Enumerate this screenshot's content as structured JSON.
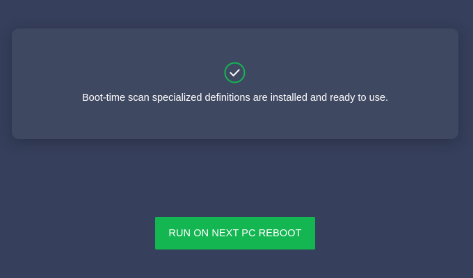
{
  "card": {
    "icon": "check-circle-icon",
    "message": "Boot-time scan specialized definitions are installed and ready to use."
  },
  "action": {
    "button_label": "RUN ON NEXT PC REBOOT"
  },
  "colors": {
    "background": "#363f5b",
    "card": "#3f4861",
    "accent_green": "#14b652",
    "text": "#ffffff"
  }
}
